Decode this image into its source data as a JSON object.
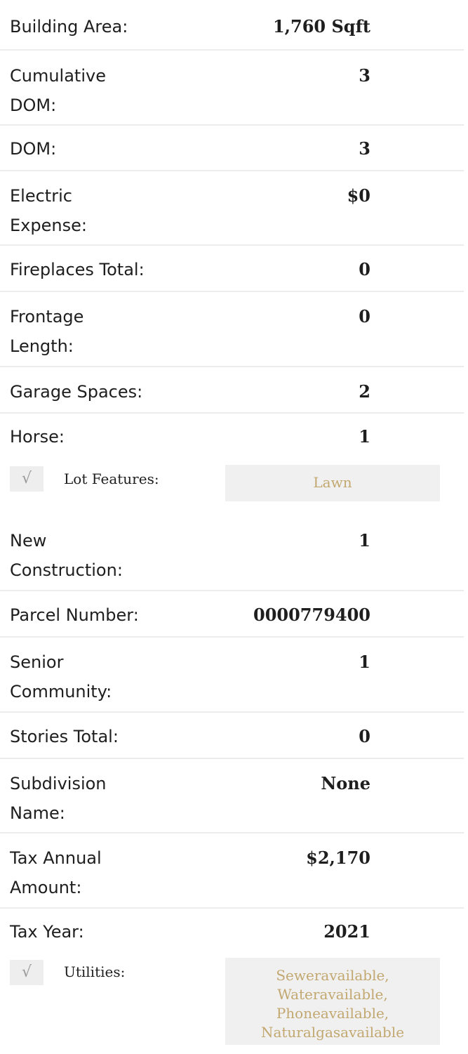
{
  "rows": [
    {
      "label": "Building Area:",
      "value": "1,760 Sqft"
    },
    {
      "label": "Cumulative DOM:",
      "value": "3"
    },
    {
      "label": "DOM:",
      "value": "3"
    },
    {
      "label": "Electric Expense:",
      "value": "$0"
    },
    {
      "label": "Fireplaces Total:",
      "value": "0"
    },
    {
      "label": "Frontage Length:",
      "value": "0"
    },
    {
      "label": "Garage Spaces:",
      "value": "2"
    },
    {
      "label": "Horse:",
      "value": "1"
    },
    {
      "label": "New Construction:",
      "value": "1"
    },
    {
      "label": "Parcel Number:",
      "value": "0000779400"
    },
    {
      "label": "Senior Community:",
      "value": "1"
    },
    {
      "label": "Stories Total:",
      "value": "0"
    },
    {
      "label": "Subdivision Name:",
      "value": "None"
    },
    {
      "label": "Tax Annual Amount:",
      "value": "$2,170"
    },
    {
      "label": "Tax Year:",
      "value": "2021"
    }
  ],
  "lot_features": {
    "check": "√",
    "label": "Lot Features:",
    "value": "Lawn"
  },
  "utilities": {
    "check": "√",
    "label": "Utilities:",
    "value": "Seweravailable, Wateravailable, Phoneavailable, Naturalgasavailable"
  },
  "colors": {
    "text": "#1e1e1e",
    "divider": "#ececec",
    "tag_bg": "#f0f0f0",
    "tag_text": "#c2a870"
  }
}
